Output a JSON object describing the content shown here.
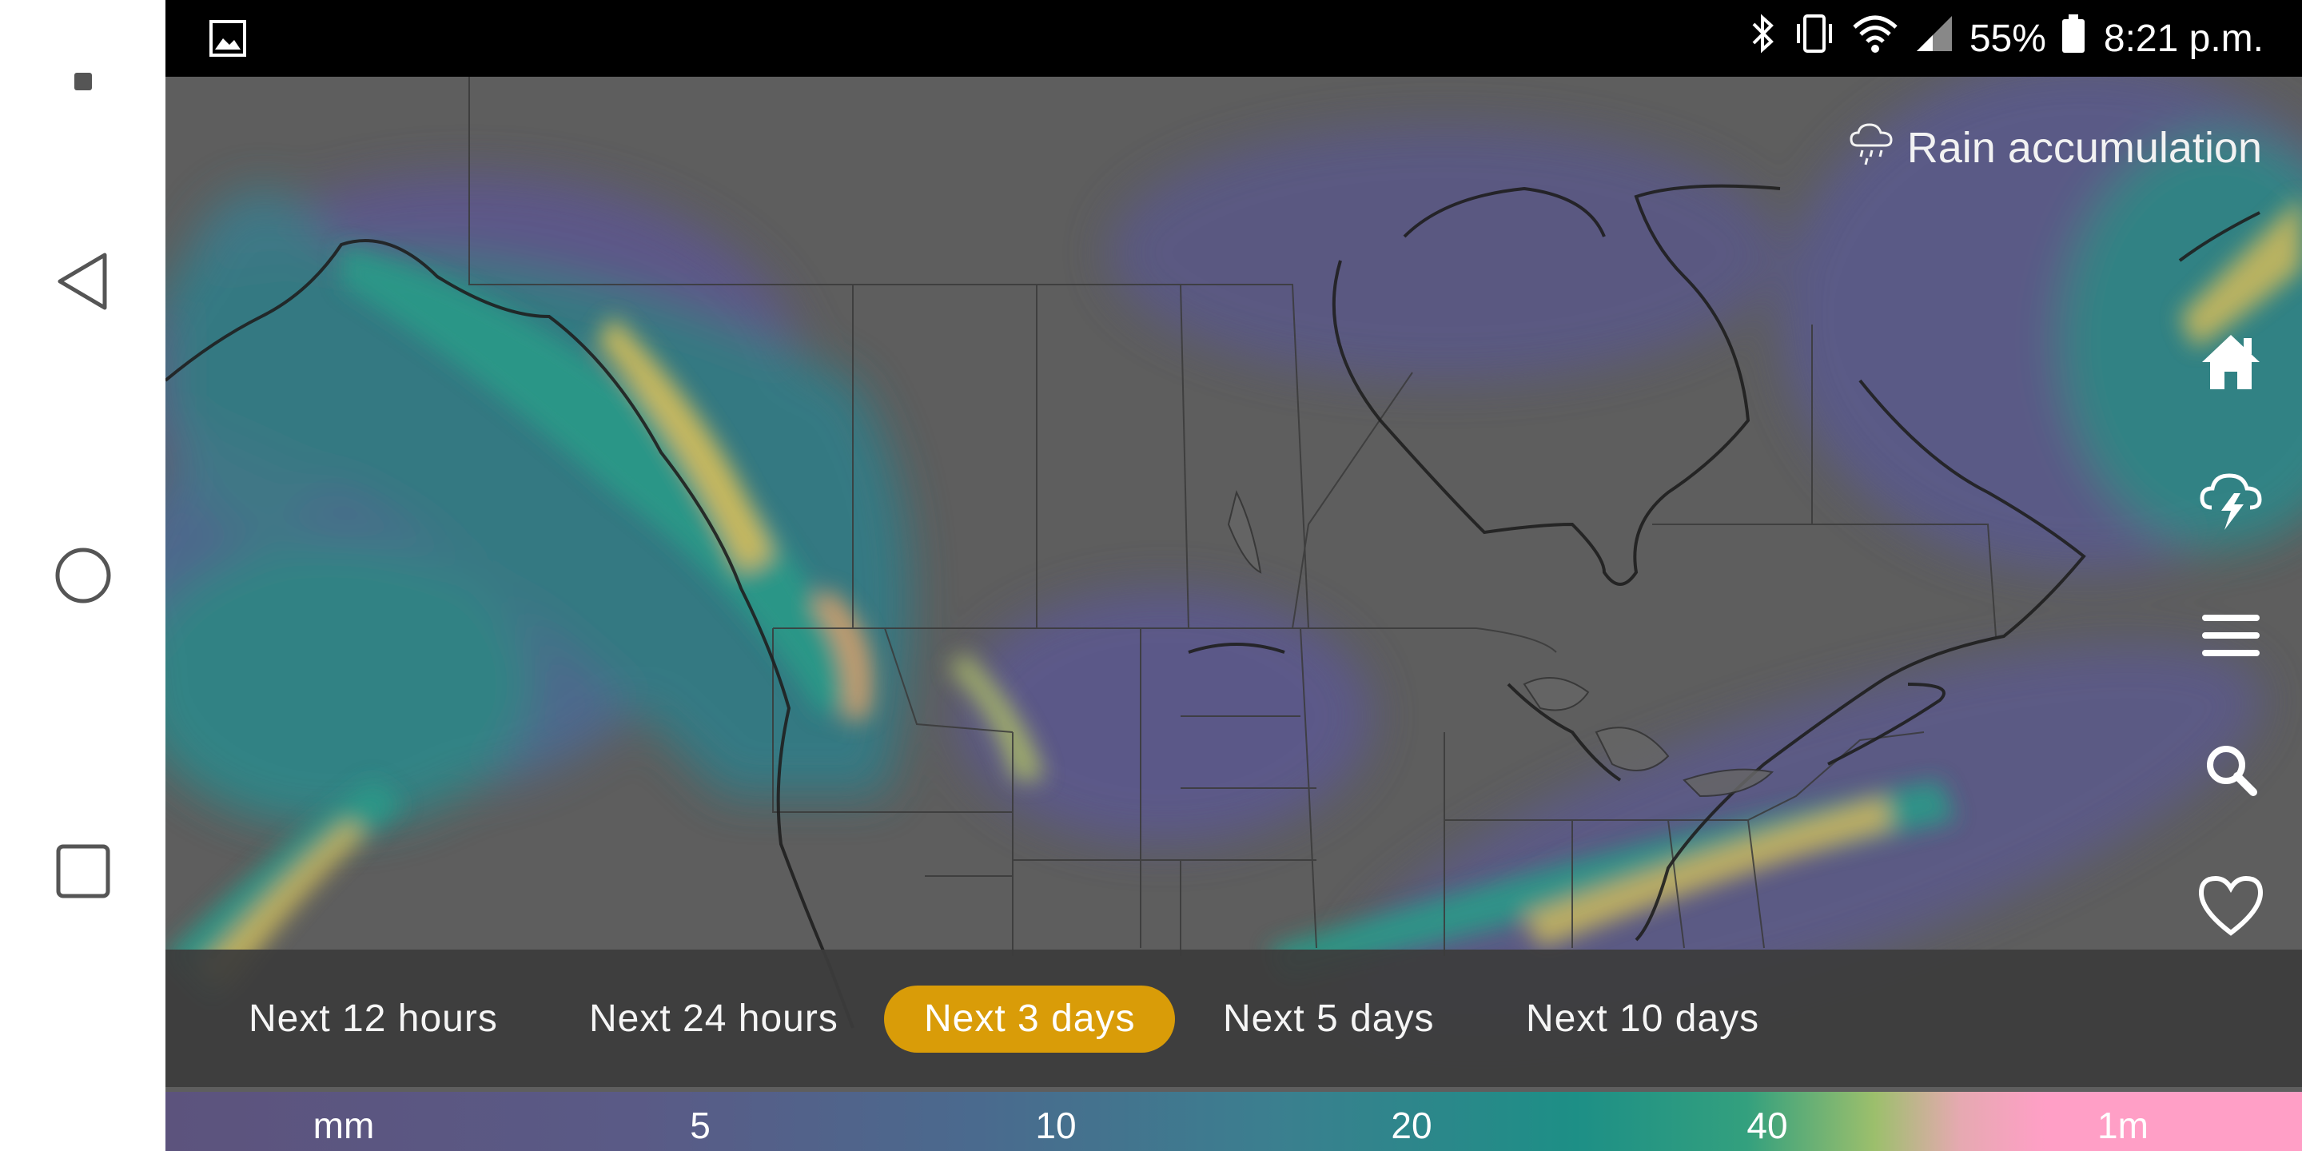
{
  "status_bar": {
    "battery_percent": "55%",
    "time": "8:21 p.m.",
    "icons": [
      "image-icon",
      "bluetooth-icon",
      "vibrate-icon",
      "wifi-icon",
      "signal-icon",
      "battery-icon"
    ]
  },
  "nav_bar": {
    "icons": [
      "recent-dot-icon",
      "back-icon",
      "home-circle-icon",
      "overview-square-icon"
    ]
  },
  "map": {
    "layer_title": "Rain accumulation",
    "layer_icon": "rain-cloud-icon",
    "side_icons": [
      "home-icon",
      "storm-icon",
      "menu-icon",
      "search-icon",
      "favorite-heart-icon"
    ]
  },
  "time_options": [
    {
      "label": "Next 12 hours",
      "selected": false
    },
    {
      "label": "Next 24 hours",
      "selected": false
    },
    {
      "label": "Next 3 days",
      "selected": true
    },
    {
      "label": "Next 5 days",
      "selected": false
    },
    {
      "label": "Next 10 days",
      "selected": false
    }
  ],
  "legend": {
    "labels": [
      "mm",
      "5",
      "10",
      "20",
      "40",
      "1m"
    ]
  },
  "colors": {
    "accent": "#d99c08",
    "map_base": "#5d5d5d"
  }
}
